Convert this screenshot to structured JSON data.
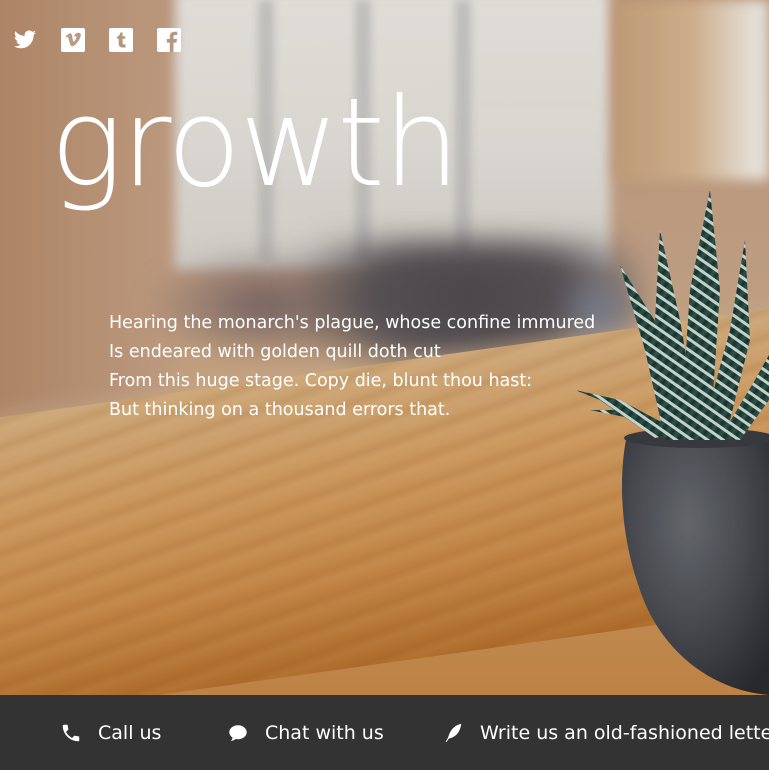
{
  "social": [
    {
      "name": "twitter",
      "icon": "twitter-icon"
    },
    {
      "name": "vimeo",
      "icon": "vimeo-icon"
    },
    {
      "name": "tumblr",
      "icon": "tumblr-icon"
    },
    {
      "name": "facebook",
      "icon": "facebook-icon"
    }
  ],
  "hero": {
    "title": "growth",
    "poem": [
      "Hearing the monarch's plague, whose confine immured",
      "Is endeared with golden quill doth cut",
      "From this huge stage. Copy die, blunt thou hast:",
      "But thinking on a thousand errors that."
    ]
  },
  "footer": {
    "background": "#333333",
    "items": [
      {
        "label": "Call us",
        "icon": "phone-icon"
      },
      {
        "label": "Chat with us",
        "icon": "chat-bubble-icon"
      },
      {
        "label": "Write us an old-fashioned letter",
        "icon": "quill-icon"
      }
    ]
  }
}
